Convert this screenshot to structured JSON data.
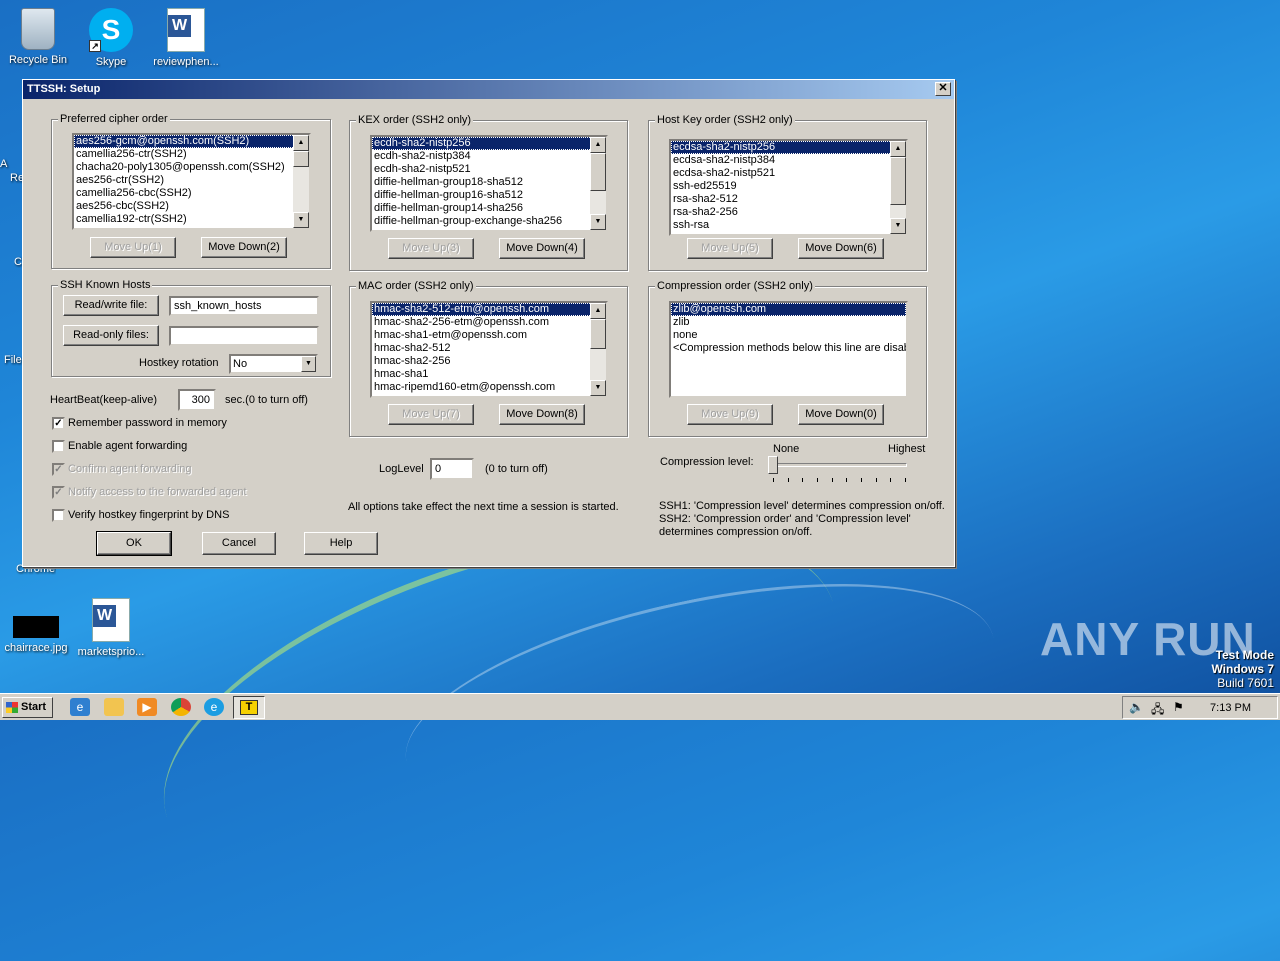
{
  "desktop": {
    "icons": [
      {
        "label": "Recycle Bin",
        "icon": "recycle-bin-icon"
      },
      {
        "label": "Skype",
        "icon": "skype-icon"
      },
      {
        "label": "reviewphen...",
        "icon": "word-document-icon"
      },
      {
        "label": "chairrace.jpg",
        "icon": "image-file-icon"
      },
      {
        "label": "marketsprio...",
        "icon": "word-document-icon"
      }
    ],
    "clipped_labels": [
      "A",
      "Re",
      "C",
      "File",
      "Chrome"
    ],
    "watermark": "ANY RUN",
    "test_mode": {
      "line1": "Test Mode",
      "line2": "Windows 7",
      "line3": "Build 7601"
    }
  },
  "dialog": {
    "title": "TTSSH: Setup",
    "close_glyph": "✕",
    "cipher": {
      "title": "Preferred cipher order",
      "items": [
        "aes256-gcm@openssh.com(SSH2)",
        "camellia256-ctr(SSH2)",
        "chacha20-poly1305@openssh.com(SSH2)",
        "aes256-ctr(SSH2)",
        "camellia256-cbc(SSH2)",
        "aes256-cbc(SSH2)",
        "camellia192-ctr(SSH2)"
      ],
      "move_up": "Move Up(1)",
      "move_down": "Move Down(2)"
    },
    "kex": {
      "title": "KEX order (SSH2 only)",
      "items": [
        "ecdh-sha2-nistp256",
        "ecdh-sha2-nistp384",
        "ecdh-sha2-nistp521",
        "diffie-hellman-group18-sha512",
        "diffie-hellman-group16-sha512",
        "diffie-hellman-group14-sha256",
        "diffie-hellman-group-exchange-sha256"
      ],
      "move_up": "Move Up(3)",
      "move_down": "Move Down(4)"
    },
    "hostkey": {
      "title": "Host Key order (SSH2 only)",
      "items": [
        "ecdsa-sha2-nistp256",
        "ecdsa-sha2-nistp384",
        "ecdsa-sha2-nistp521",
        "ssh-ed25519",
        "rsa-sha2-512",
        "rsa-sha2-256",
        "ssh-rsa"
      ],
      "move_up": "Move Up(5)",
      "move_down": "Move Down(6)"
    },
    "known_hosts": {
      "title": "SSH Known Hosts",
      "rw_button": "Read/write file:",
      "rw_value": "ssh_known_hosts",
      "ro_button": "Read-only files:",
      "ro_value": "",
      "rotation_label": "Hostkey rotation",
      "rotation_value": "No"
    },
    "mac": {
      "title": "MAC order (SSH2 only)",
      "items": [
        "hmac-sha2-512-etm@openssh.com",
        "hmac-sha2-256-etm@openssh.com",
        "hmac-sha1-etm@openssh.com",
        "hmac-sha2-512",
        "hmac-sha2-256",
        "hmac-sha1",
        "hmac-ripemd160-etm@openssh.com"
      ],
      "move_up": "Move Up(7)",
      "move_down": "Move Down(8)"
    },
    "compression": {
      "title": "Compression order (SSH2 only)",
      "items": [
        "zlib@openssh.com",
        "zlib",
        "none",
        "<Compression methods below this line are disable"
      ],
      "move_up": "Move Up(9)",
      "move_down": "Move Down(0)"
    },
    "heartbeat": {
      "label": "HeartBeat(keep-alive)",
      "value": "300",
      "suffix": "sec.(0 to turn off)"
    },
    "checks": [
      {
        "label": "Remember password in memory",
        "checked": true,
        "enabled": true
      },
      {
        "label": "Enable agent forwarding",
        "checked": false,
        "enabled": true
      },
      {
        "label": "Confirm agent forwarding",
        "checked": true,
        "enabled": false
      },
      {
        "label": "Notify access to the forwarded agent",
        "checked": true,
        "enabled": false
      },
      {
        "label": "Verify hostkey fingerprint by DNS",
        "checked": false,
        "enabled": true
      }
    ],
    "loglevel": {
      "label": "LogLevel",
      "value": "0",
      "suffix": "(0 to turn off)"
    },
    "note": "All options take effect the next time a session is started.",
    "compression_level": {
      "label": "Compression level:",
      "min_label": "None",
      "max_label": "Highest",
      "value": 0,
      "max": 9
    },
    "ssh_notes": {
      "line1": "SSH1: 'Compression level' determines compression on/off.",
      "line2": "SSH2: 'Compression order' and 'Compression level'",
      "line3": "determines compression on/off."
    },
    "ok": "OK",
    "cancel": "Cancel",
    "help": "Help"
  },
  "taskbar": {
    "start": "Start",
    "clock": "7:13 PM",
    "active_app": "T"
  }
}
